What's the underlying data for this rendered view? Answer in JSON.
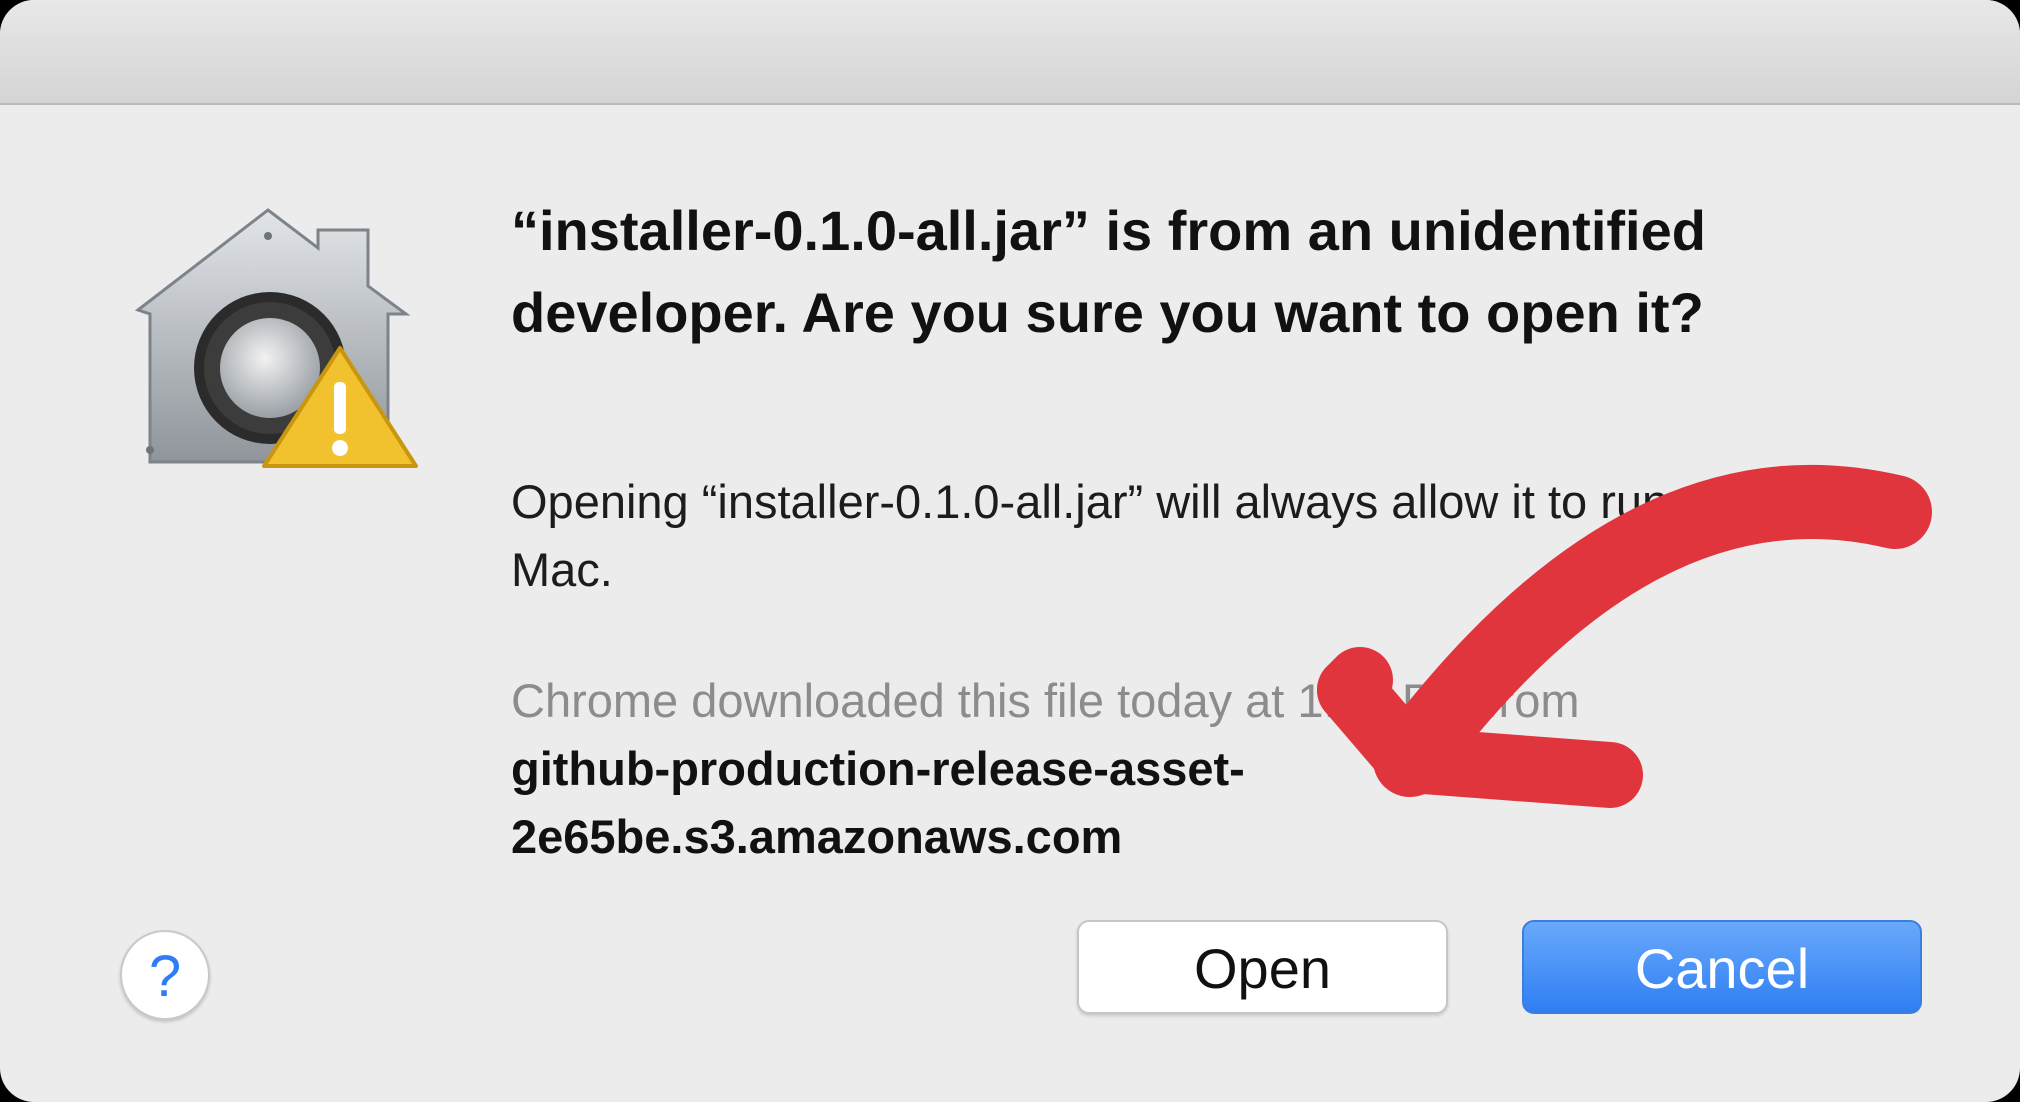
{
  "dialog": {
    "headline": "“installer-0.1.0-all.jar” is from an unidentified developer. Are you sure you want to open it?",
    "info": "Opening “installer-0.1.0-all.jar” will always allow it to run on this Mac.",
    "source_line": "Chrome downloaded this file today at 1:14 PM from",
    "source_host": "github-production-release-asset-2e65be.s3.amazonaws.com",
    "help_label": "?",
    "open_label": "Open",
    "cancel_label": "Cancel"
  },
  "icons": {
    "app_icon": "gatekeeper-lock-house-icon",
    "badge": "warning-triangle-icon",
    "annotation": "red-arrow-annotation"
  },
  "colors": {
    "accent": "#2e7ef3",
    "warning": "#f2c12e",
    "annotation": "#e0353d"
  }
}
